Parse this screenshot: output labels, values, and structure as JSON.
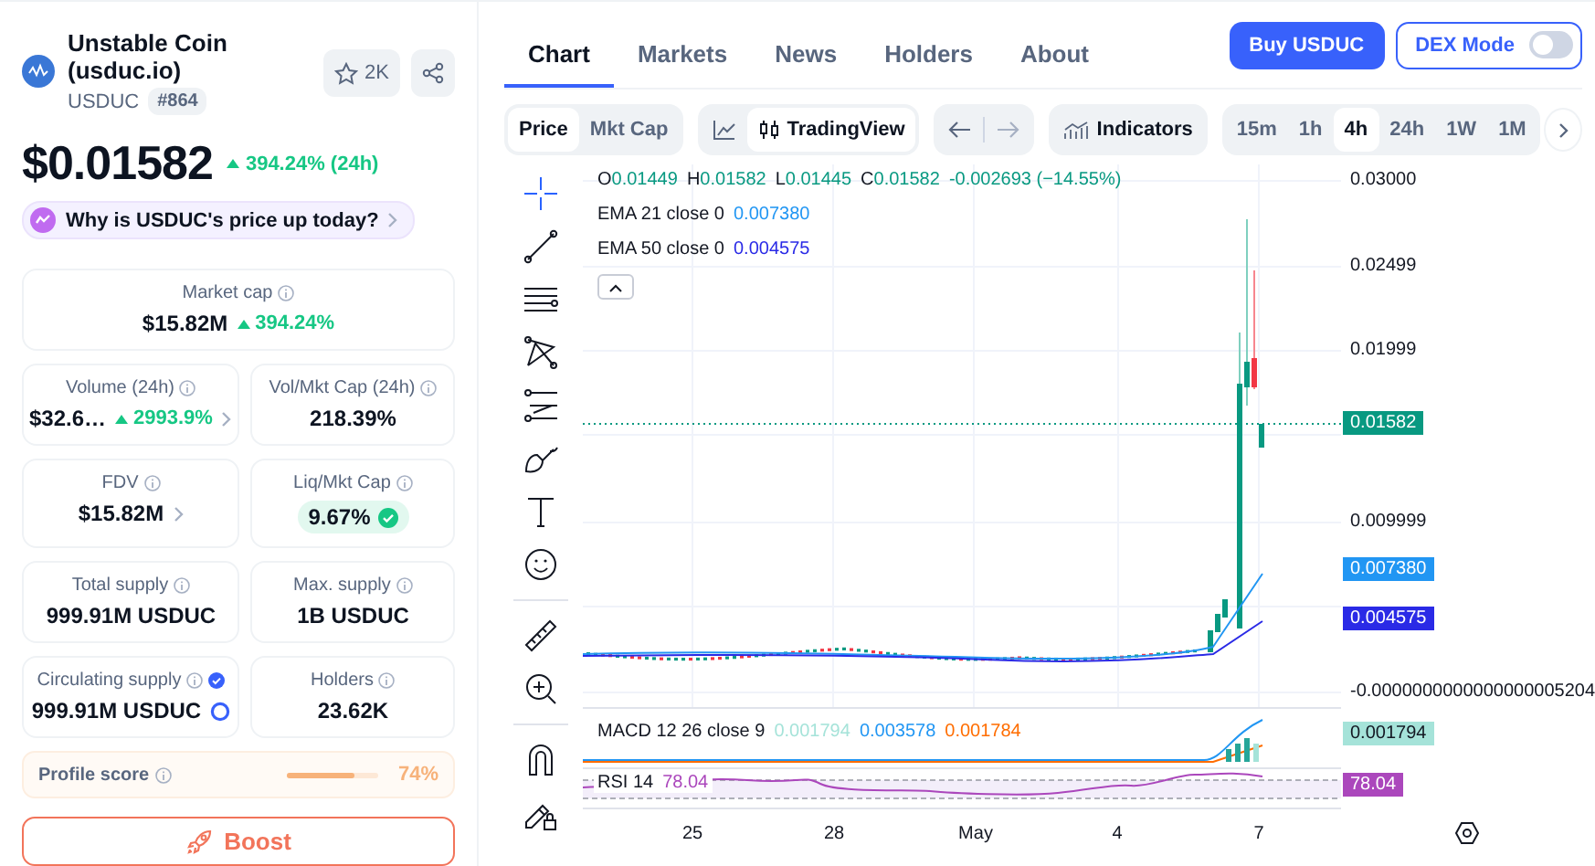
{
  "coin": {
    "name": "Unstable Coin (usduc.io)",
    "symbol": "USDUC",
    "rank": "#864",
    "watchlist_count": "2K",
    "price": "$0.01582",
    "change": "394.24% (24h)",
    "prompt": "Why is USDUC's price up today?"
  },
  "market_cap": {
    "label": "Market cap",
    "value": "$15.82M",
    "change": "394.24%"
  },
  "stats": [
    {
      "kind": "link",
      "label": "Volume (24h)",
      "value": "$32.6…",
      "change": "2993.9%"
    },
    {
      "kind": "plain",
      "label": "Vol/Mkt Cap (24h)",
      "value": "218.39%"
    },
    {
      "kind": "link",
      "label": "FDV",
      "value": "$15.82M"
    },
    {
      "kind": "pill",
      "label": "Liq/Mkt Cap",
      "value": "9.67%"
    },
    {
      "kind": "plain",
      "label": "Total supply",
      "value": "999.91M USDUC"
    },
    {
      "kind": "plain",
      "label": "Max. supply",
      "value": "1B USDUC"
    },
    {
      "kind": "verified",
      "label": "Circulating supply",
      "value": "999.91M USDUC"
    },
    {
      "kind": "plain",
      "label": "Holders",
      "value": "23.62K"
    }
  ],
  "profile_score": {
    "label": "Profile score",
    "level": 0.74,
    "reading": "74%"
  },
  "boost_button": "Boost",
  "tabs": [
    {
      "label": "Chart",
      "selected": true
    },
    {
      "label": "Markets",
      "selected": false
    },
    {
      "label": "News",
      "selected": false
    },
    {
      "label": "Holders",
      "selected": false
    },
    {
      "label": "About",
      "selected": false
    }
  ],
  "buy_button": "Buy USDUC",
  "dex_mode": {
    "label": "DEX Mode",
    "on": false
  },
  "value_toggle": [
    {
      "label": "Price",
      "selected": true
    },
    {
      "label": "Mkt Cap",
      "selected": false
    }
  ],
  "chart_style": [
    {
      "kind": "line",
      "selected": false
    },
    {
      "kind": "candles",
      "label": "TradingView",
      "selected": true
    }
  ],
  "indicators_button": "Indicators",
  "timeframes": [
    {
      "label": "15m",
      "selected": false
    },
    {
      "label": "1h",
      "selected": false
    },
    {
      "label": "4h",
      "selected": true
    },
    {
      "label": "24h",
      "selected": false
    },
    {
      "label": "1W",
      "selected": false
    },
    {
      "label": "1M",
      "selected": false
    }
  ],
  "chart": {
    "ohlc": [
      {
        "label": "O",
        "value": "0.01449"
      },
      {
        "label": "H",
        "value": "0.01582"
      },
      {
        "label": "L",
        "value": "0.01445"
      },
      {
        "label": "C",
        "value": "0.01582"
      }
    ],
    "change": "-0.002693 (−14.55%)",
    "studies": [
      {
        "label": "EMA 21 close 0",
        "values": [
          {
            "text": "0.007380",
            "color": "#2196f3"
          }
        ]
      },
      {
        "label": "EMA 50 close 0",
        "values": [
          {
            "text": "0.004575",
            "color": "#2a2ae6"
          }
        ]
      }
    ],
    "price_ticks": [
      "0.03000",
      "0.02499",
      "0.01999",
      "0.009999",
      "-0.0000000000000000005204"
    ],
    "price_badges": [
      {
        "text": "0.01582",
        "color": "#089981"
      },
      {
        "text": "0.007380",
        "color": "#2196f3"
      },
      {
        "text": "0.004575",
        "color": "#2a2ae6"
      }
    ],
    "macd": {
      "label": "MACD 12 26 close 9",
      "values": [
        {
          "text": "0.001794",
          "color": "#a5e3d9"
        },
        {
          "text": "0.003578",
          "color": "#2196f3"
        },
        {
          "text": "0.001784",
          "color": "#ff6d00"
        }
      ]
    },
    "macd_badges": [
      {
        "text": "0.001794",
        "color": "#a5e3d9"
      }
    ],
    "rsi": {
      "label": "RSI 14",
      "values": [
        {
          "text": "78.04",
          "color": "#ab47bc"
        }
      ]
    },
    "rsi_badges": [
      {
        "text": "78.04",
        "color": "#ab47bc"
      }
    ],
    "time_ticks": [
      "25",
      "28",
      "May",
      "4",
      "7"
    ]
  }
}
